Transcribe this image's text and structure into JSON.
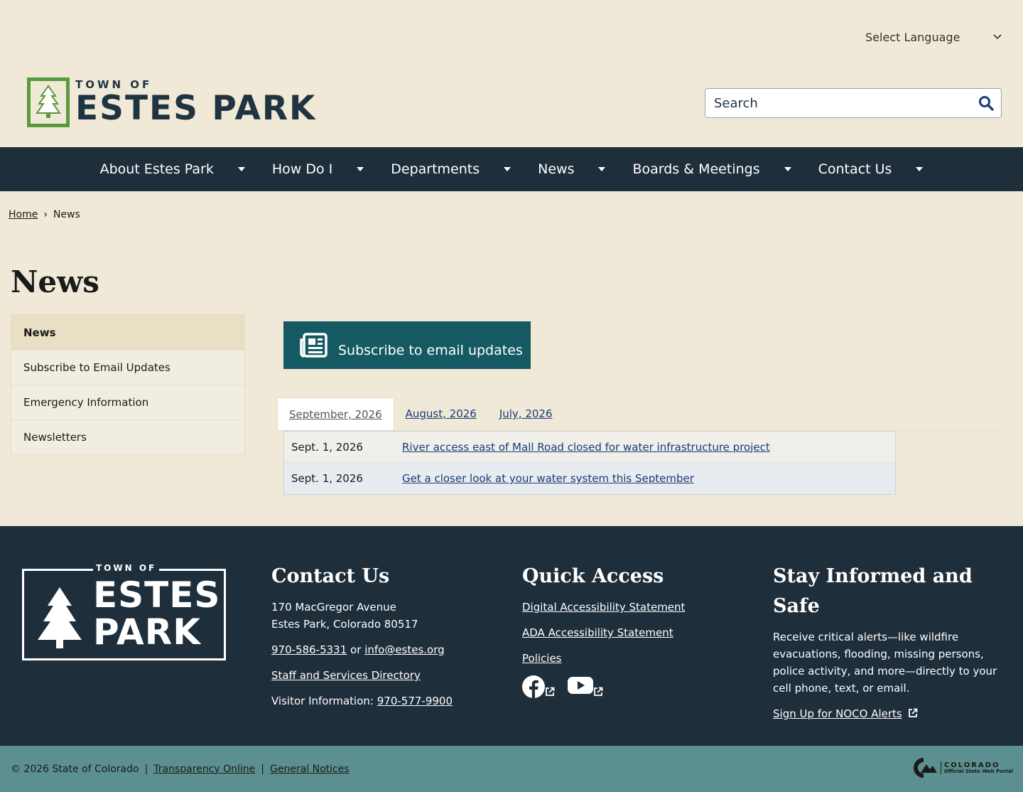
{
  "header": {
    "language_select": "Select Language",
    "logo_small": "TOWN OF",
    "logo_big": "ESTES PARK",
    "search_placeholder": "Search"
  },
  "nav": {
    "items": [
      "About Estes Park",
      "How Do I",
      "Departments",
      "News",
      "Boards & Meetings",
      "Contact Us"
    ]
  },
  "breadcrumb": {
    "home": "Home",
    "separator": "›",
    "current": "News"
  },
  "page_title": "News",
  "side_nav": {
    "items": [
      "News",
      "Subscribe to Email Updates",
      "Emergency Information",
      "Newsletters"
    ],
    "active_index": 0
  },
  "subscribe": {
    "label": "Subscribe to email updates",
    "icon": "newspaper-icon"
  },
  "tabs": [
    "September, 2026",
    "August, 2026",
    "July, 2026"
  ],
  "news": [
    {
      "date": "Sept. 1, 2026",
      "title": "River access east of Mall Road closed for water infrastructure project"
    },
    {
      "date": "Sept. 1, 2026",
      "title": "Get a closer look at your water system this September"
    }
  ],
  "footer": {
    "logo_small": "TOWN OF",
    "logo_line1": "ESTES",
    "logo_line2": "PARK",
    "contact": {
      "heading": "Contact Us",
      "address1": "170 MacGregor Avenue",
      "address2": "Estes Park, Colorado 80517",
      "phone": "970-586-5331",
      "or": "or",
      "email": "info@estes.org",
      "directory": "Staff and Services Directory",
      "visitor_label": "Visitor Information:",
      "visitor_phone": "970-577-9900"
    },
    "quick": {
      "heading": "Quick Access",
      "links": [
        "Digital Accessibility Statement",
        "ADA Accessibility Statement",
        "Policies"
      ]
    },
    "stay": {
      "heading": "Stay Informed and Safe",
      "text": "Receive critical alerts—like wildfire evacuations, flooding, missing persons, police activity, and more—directly to your cell phone, text, or email.",
      "link": "Sign Up for NOCO Alerts"
    }
  },
  "bottom": {
    "copyright": "© 2026 State of Colorado",
    "sep": "|",
    "link1": "Transparency Online",
    "link2": "General Notices",
    "co_title": "COLORADO",
    "co_sub": "Official State Web Portal"
  },
  "colors": {
    "background": "#f0e9d7",
    "nav_bg": "#1e2e3b",
    "accent_teal": "#155a62",
    "logo_green": "#5a9a3c",
    "bottom_bar": "#5c8f8f"
  }
}
